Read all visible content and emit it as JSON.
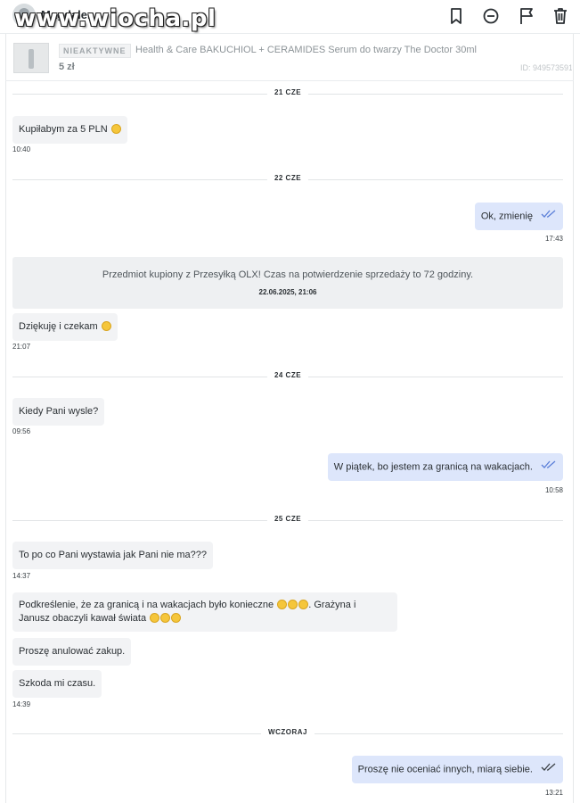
{
  "header": {
    "username": "Magdalena",
    "watermark": "www.wiocha.pl",
    "icons": [
      "bookmark-icon",
      "minus-circle-icon",
      "flag-icon",
      "trash-icon"
    ]
  },
  "listing": {
    "status_badge": "NIEAKTYWNE",
    "title": "Health & Care BAKUCHIOL + CERAMIDES Serum do twarzy The Doctor 30ml",
    "price": "5 zł",
    "id": "ID: 949573591"
  },
  "dividers": [
    "21 CZE",
    "22 CZE",
    "24 CZE",
    "25 CZE",
    "WCZORAJ"
  ],
  "messages": [
    {
      "text": "Kupiłabym za 5 PLN",
      "time": "10:40"
    },
    {
      "text": "Ok, zmienię",
      "time": "17:43"
    },
    {
      "text": "Dziękuję i czekam",
      "time": "21:07"
    },
    {
      "text": "Kiedy Pani wysle?",
      "time": "09:56"
    },
    {
      "text": "W piątek, bo jestem za granicą na wakacjach.",
      "time": "10:58"
    },
    {
      "text": "To po co Pani wystawia jak Pani nie ma???",
      "time": "14:37"
    },
    {
      "text": "Podkreślenie, że za granicą i na wakacjach było konieczne",
      "time": ""
    },
    {
      "text": ". Grażyna i",
      "time": ""
    },
    {
      "text": "Janusz obaczyli kawał świata",
      "time": ""
    },
    {
      "text": "Proszę anulować zakup.",
      "time": ""
    },
    {
      "text": "Szkoda mi czasu.",
      "time": "14:39"
    },
    {
      "text": "Proszę nie oceniać innych, miarą siebie.",
      "time": "13:21"
    }
  ],
  "system": {
    "text": "Przedmiot kupiony z Przesyłką OLX! Czas na potwierdzenie sprzedaży to 72 godziny.",
    "date": "22.06.2025, 21:06"
  },
  "colors": {
    "incoming_bubble": "#f2f3f5",
    "outgoing_bubble": "#dde6fb",
    "read_ticks": "#5b7fd8"
  }
}
